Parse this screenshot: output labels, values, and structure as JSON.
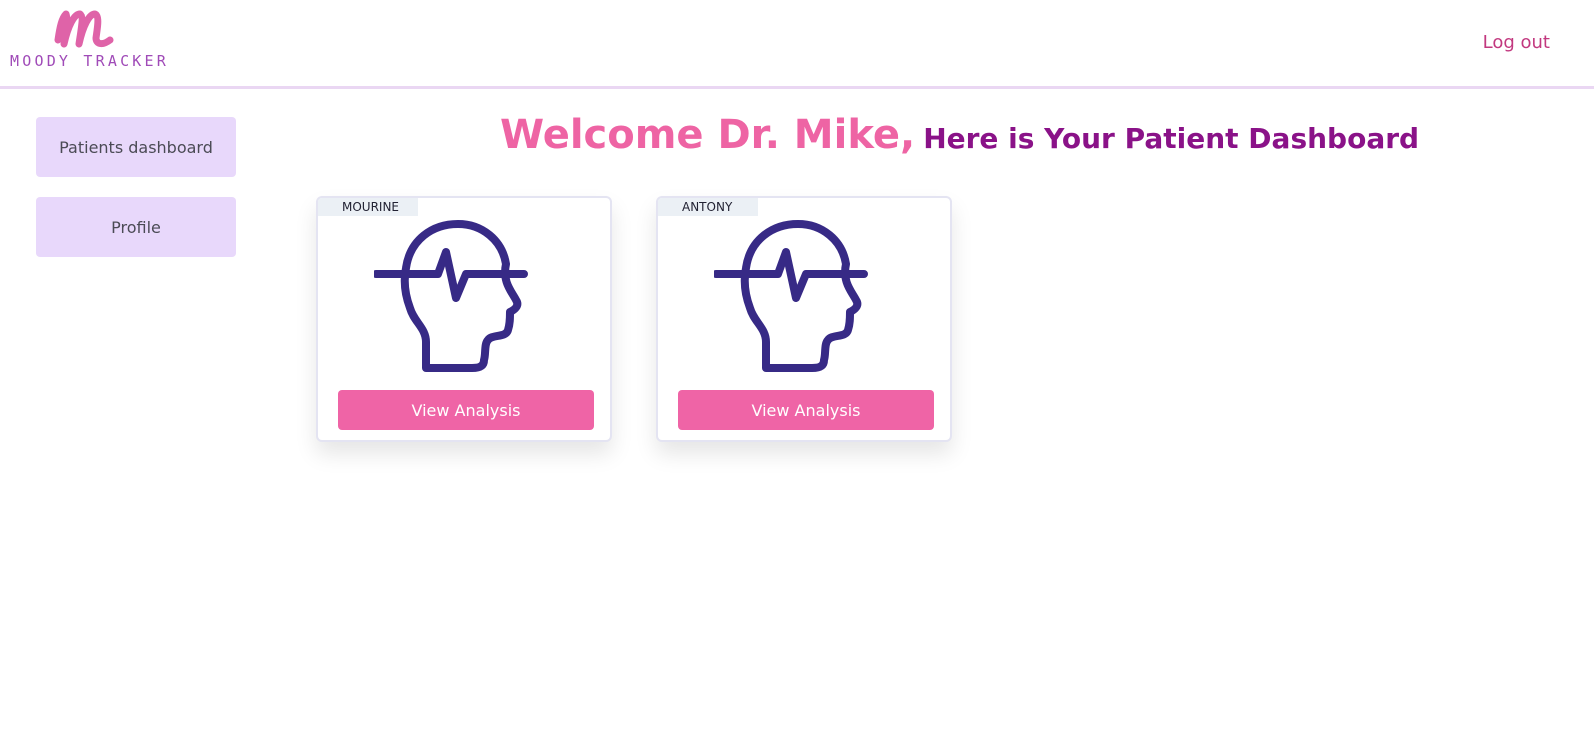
{
  "header": {
    "logo_text": "MOODY TRACKER",
    "logout_label": "Log out"
  },
  "sidebar": {
    "items": [
      {
        "label": "Patients dashboard"
      },
      {
        "label": "Profile"
      }
    ]
  },
  "main": {
    "welcome": "Welcome Dr. Mike,",
    "subtitle": "Here is Your Patient Dashboard",
    "patients": [
      {
        "name": "MOURINE",
        "button_label": "View Analysis",
        "icon": "head-pulse-icon"
      },
      {
        "name": "ANTONY",
        "button_label": "View Analysis",
        "icon": "head-pulse-icon"
      }
    ]
  },
  "colors": {
    "accent_pink": "#ef64a6",
    "accent_purple": "#8a1288",
    "icon_indigo": "#372a86",
    "sidebar_bg": "#e8d8fb"
  }
}
